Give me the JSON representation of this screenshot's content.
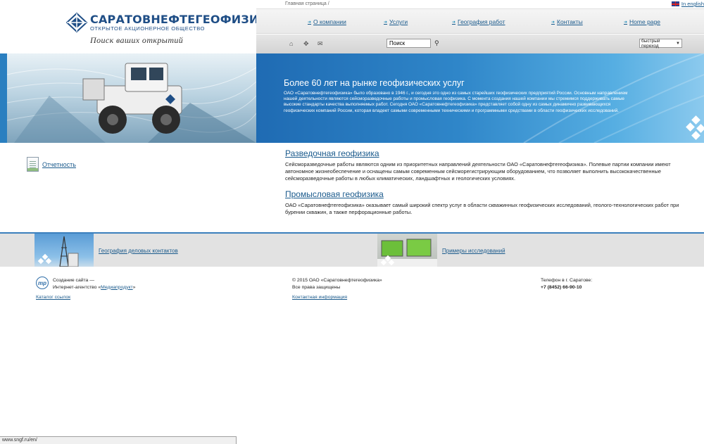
{
  "header": {
    "logo_name": "САРАТОВНЕФТЕГЕОФИЗИКА",
    "logo_sub": "ОТКРЫТОЕ АКЦИОНЕРНОЕ ОБЩЕСТВО",
    "slogan": "Поиск ваших открытий",
    "breadcrumb": "Главная страница /",
    "lang_label": "In english"
  },
  "menu": {
    "items": [
      {
        "label": "О компании"
      },
      {
        "label": "Услуги"
      },
      {
        "label": "География работ"
      },
      {
        "label": "Контакты"
      },
      {
        "label": "Home page"
      }
    ]
  },
  "toolbar": {
    "icons": [
      "home-icon",
      "sitemap-icon",
      "mail-icon"
    ],
    "search_value": "Поиск",
    "quick_nav_label": "быстрый переход"
  },
  "banner": {
    "title": "Более 60 лет на рынке геофизических услуг",
    "text": "ОАО «Саратовнефтегеофизика» было образовано в 1946 г., и сегодня это одно из самых старейших геофизических предприятий России. Основным направлением нашей деятельности являются сейсморазведочные работы и промысловая геофизика. С момента создания нашей компании мы стремимся поддерживать самые высокие стандарты качества выполняемых работ. Сегодня ОАО «Саратовнефтегеофизика» представляет собой одну из самых динамично развивающихся геофизических компаний России, которая владеет самыми современными техническими и программными средствами в области геофизических исследований."
  },
  "sidebar": {
    "report_label": "Отчетность"
  },
  "sections": [
    {
      "title": "Разведочная геофизика",
      "text": "Сейсморазведочные работы являются одним из приоритетных направлений деятельности ОАО «Саратовнефтегеофизика». Полевые партии компании имеют автономное жизнеобеспечение и оснащены самым современным сейсморегистрирующим оборудованием, что позволяет выполнить высококачественные сейсморазведочные работы в любых климатических, ландшафтных и геологических условиях."
    },
    {
      "title": "Промысловая геофизика",
      "text": "ОАО «Саратовнефтегеофизика» оказывает самый широкий спектр услуг в области скважинных геофизических исследований, геолого-технологических работ при бурении скважин, а также перфорационные работы."
    }
  ],
  "promo": {
    "link1": "География деловых контактов",
    "link2": "Примеры исследований"
  },
  "footer": {
    "mp_logo": "mp",
    "create_line1": "Создание сайта —",
    "create_line2_prefix": "Интернет-агентство «",
    "create_agency": "Медиапродукт",
    "create_line2_suffix": "»",
    "catalog_link": "Каталог ссылок",
    "copyright": "© 2015 ОАО «Саратовнефтегеофизика»",
    "rights": "Все права защищены",
    "contact_link": "Контактная информация",
    "phone_label": "Телефон в г. Саратове:",
    "phone_number": "+7 (8452) 66-90-10"
  },
  "statusbar": {
    "url": "www.sngf.ru/en/"
  },
  "colors": {
    "brand_blue": "#1f4e86",
    "link_blue": "#1a5a8c",
    "banner_blue": "#2f86c9"
  }
}
